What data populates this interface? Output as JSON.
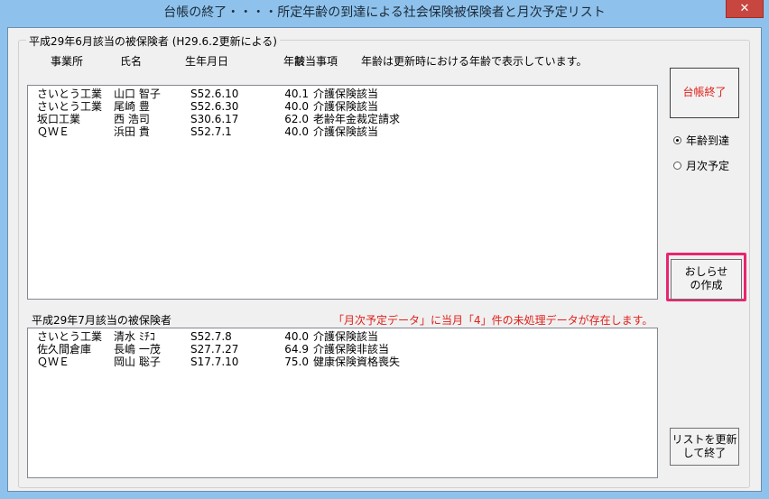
{
  "window": {
    "title": "台帳の終了・・・・所定年齢の到達による社会保険被保険者と月次予定リスト",
    "close_glyph": "✕"
  },
  "group1": {
    "legend": "平成29年6月該当の被保険者 (H29.6.2更新による)"
  },
  "columns": {
    "office": "事業所",
    "name": "氏名",
    "birth": "生年月日",
    "age": "年齢",
    "matter": "該当事項",
    "note": "年齢は更新時における年齢で表示しています。"
  },
  "list1": [
    {
      "office": "さいとう工業",
      "name": "山口 智子",
      "birth": "S52.6.10",
      "age": "40.1",
      "matter": "介護保険該当"
    },
    {
      "office": "さいとう工業",
      "name": "尾崎 豊",
      "birth": "S52.6.30",
      "age": "40.0",
      "matter": "介護保険該当"
    },
    {
      "office": "坂口工業",
      "name": "西 浩司",
      "birth": "S30.6.17",
      "age": "62.0",
      "matter": "老齢年金裁定請求"
    },
    {
      "office": "ＱＷＥ",
      "name": "浜田 貴",
      "birth": "S52.7.1",
      "age": "40.0",
      "matter": "介護保険該当"
    }
  ],
  "group2": {
    "caption": "平成29年7月該当の被保険者",
    "warning": "「月次予定データ」に当月「4」件の未処理データが存在します。"
  },
  "list2": [
    {
      "office": "さいとう工業",
      "name": "清水 ﾐﾁｺ",
      "birth": "S52.7.8",
      "age": "40.0",
      "matter": "介護保険該当"
    },
    {
      "office": "佐久間倉庫",
      "name": "長嶋 一茂",
      "birth": "S27.7.27",
      "age": "64.9",
      "matter": "介護保険非該当"
    },
    {
      "office": "ＱＷＥ",
      "name": "岡山 聡子",
      "birth": "S17.7.10",
      "age": "75.0",
      "matter": "健康保険資格喪失"
    }
  ],
  "buttons": {
    "close_ledger": "台帳終了",
    "notice_line1": "おしらせ",
    "notice_line2": "の作成",
    "refresh_line1": "リストを更新",
    "refresh_line2": "して終了"
  },
  "radios": {
    "age_reached": "年齢到達",
    "monthly_plan": "月次予定",
    "selected": "age_reached"
  },
  "colors": {
    "warning": "#e0201a",
    "highlight": "#e8256f",
    "titlebar": "#8ec2ec"
  }
}
